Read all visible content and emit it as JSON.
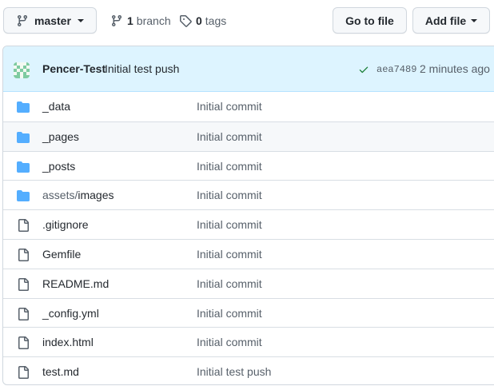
{
  "toolbar": {
    "branch_label": "master",
    "branches_count": "1",
    "branches_label": "branch",
    "tags_count": "0",
    "tags_label": "tags",
    "go_to_file_label": "Go to file",
    "add_file_label": "Add file"
  },
  "commit": {
    "author": "Pencer-Test",
    "message": "Initial test push",
    "sha": "aea7489",
    "time_ago": "2 minutes ago",
    "status": "success"
  },
  "colors": {
    "folder": "#54aeff",
    "check": "#1a7f37",
    "commit_bar": "#ddf4ff"
  },
  "files": [
    {
      "type": "folder-icon",
      "prefix": "",
      "name": "_data",
      "message": "Initial commit"
    },
    {
      "type": "folder-icon",
      "prefix": "",
      "name": "_pages",
      "message": "Initial commit"
    },
    {
      "type": "folder-icon",
      "prefix": "",
      "name": "_posts",
      "message": "Initial commit"
    },
    {
      "type": "folder-icon",
      "prefix": "assets/",
      "name": "images",
      "message": "Initial commit"
    },
    {
      "type": "file-icon",
      "prefix": "",
      "name": ".gitignore",
      "message": "Initial commit"
    },
    {
      "type": "file-icon",
      "prefix": "",
      "name": "Gemfile",
      "message": "Initial commit"
    },
    {
      "type": "file-icon",
      "prefix": "",
      "name": "README.md",
      "message": "Initial commit"
    },
    {
      "type": "file-icon",
      "prefix": "",
      "name": "_config.yml",
      "message": "Initial commit"
    },
    {
      "type": "file-icon",
      "prefix": "",
      "name": "index.html",
      "message": "Initial commit"
    },
    {
      "type": "file-icon",
      "prefix": "",
      "name": "test.md",
      "message": "Initial test push"
    }
  ]
}
